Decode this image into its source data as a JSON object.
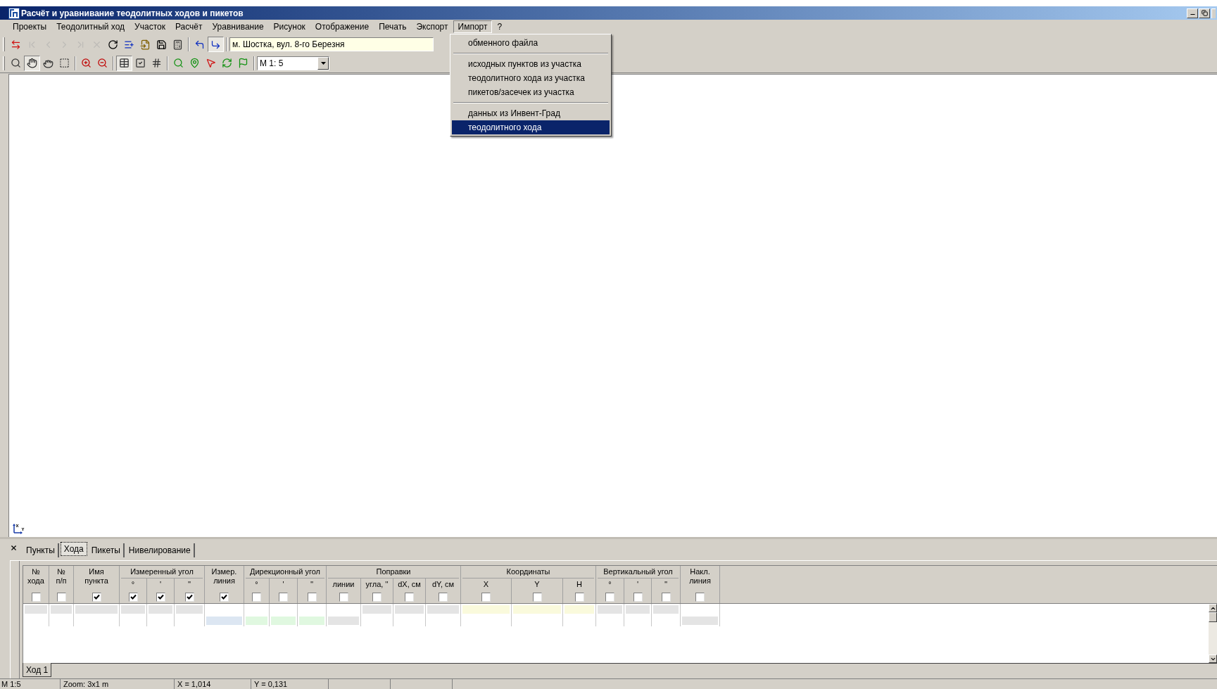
{
  "window": {
    "title": "Расчёт и уравнивание теодолитных ходов и пикетов"
  },
  "menu_bar": [
    {
      "label": "Проекты",
      "open": false
    },
    {
      "label": "Теодолитный ход",
      "open": false
    },
    {
      "label": "Участок",
      "open": false
    },
    {
      "label": "Расчёт",
      "open": false
    },
    {
      "label": "Уравнивание",
      "open": false
    },
    {
      "label": "Рисунок",
      "open": false
    },
    {
      "label": "Отображение",
      "open": false
    },
    {
      "label": "Печать",
      "open": false
    },
    {
      "label": "Экспорт",
      "open": false
    },
    {
      "label": "Импорт",
      "open": true
    },
    {
      "label": "?",
      "open": false
    }
  ],
  "import_menu": {
    "groups": [
      {
        "items": [
          {
            "label": "обменного файла",
            "selected": false
          }
        ]
      },
      {
        "items": [
          {
            "label": "исходных пунктов из участка",
            "selected": false
          },
          {
            "label": "теодолитного хода из участка",
            "selected": false
          },
          {
            "label": "пикетов/засечек из участка",
            "selected": false
          }
        ]
      },
      {
        "items": [
          {
            "label": "данных из Инвент-Град",
            "selected": false
          },
          {
            "label": "теодолитного хода",
            "selected": true
          }
        ]
      }
    ]
  },
  "toolbar_1": {
    "groups": [
      {
        "items": [
          {
            "kind": "swap",
            "disabled": false,
            "pressed": false
          },
          {
            "kind": "first",
            "disabled": true,
            "pressed": false
          },
          {
            "kind": "prev",
            "disabled": true,
            "pressed": false
          },
          {
            "kind": "next",
            "disabled": true,
            "pressed": false
          },
          {
            "kind": "last",
            "disabled": true,
            "pressed": false
          },
          {
            "kind": "delete",
            "disabled": true,
            "pressed": false
          },
          {
            "kind": "refresh",
            "disabled": false,
            "pressed": false
          },
          {
            "kind": "insert",
            "disabled": false,
            "pressed": false
          },
          {
            "kind": "import",
            "disabled": false,
            "pressed": false
          },
          {
            "kind": "save",
            "disabled": false,
            "pressed": false
          },
          {
            "kind": "calculator",
            "disabled": false,
            "pressed": false
          }
        ]
      },
      {
        "items": [
          {
            "kind": "back",
            "disabled": false,
            "pressed": false
          },
          {
            "kind": "forward",
            "disabled": false,
            "pressed": true
          }
        ]
      }
    ],
    "address": "м. Шостка, вул. 8-го Березня"
  },
  "toolbar_2": {
    "groups": [
      {
        "items": [
          {
            "kind": "zoom-window",
            "pressed": false
          },
          {
            "kind": "pan",
            "pressed": true
          },
          {
            "kind": "pan-alt",
            "pressed": false
          },
          {
            "kind": "select",
            "pressed": false
          }
        ]
      },
      {
        "items": [
          {
            "kind": "zoom-in",
            "pressed": false
          },
          {
            "kind": "zoom-out",
            "pressed": false
          }
        ]
      },
      {
        "items": [
          {
            "kind": "table",
            "pressed": true
          },
          {
            "kind": "table-check",
            "pressed": false
          },
          {
            "kind": "table-number",
            "pressed": false
          }
        ]
      },
      {
        "items": [
          {
            "kind": "green-search",
            "pressed": false
          },
          {
            "kind": "green-pin",
            "pressed": false
          },
          {
            "kind": "green-pointer",
            "pressed": false
          },
          {
            "kind": "green-rotate",
            "pressed": false
          },
          {
            "kind": "green-flag",
            "pressed": false
          }
        ]
      }
    ],
    "scale": "М 1: 5"
  },
  "panel_tabs": [
    {
      "label": "Пункты",
      "selected": false
    },
    {
      "label": "Хода",
      "selected": true
    },
    {
      "label": "Пикеты",
      "selected": false
    },
    {
      "label": "Нивелирование",
      "selected": false
    }
  ],
  "grid": {
    "columns": [
      {
        "kind": "single",
        "label": "№\nхода",
        "checked": false,
        "cells": [
          {
            "kind": "computed"
          },
          {
            "kind": "empty"
          }
        ]
      },
      {
        "kind": "single",
        "label": "№\nп/п",
        "checked": false,
        "cells": [
          {
            "kind": "computed"
          },
          {
            "kind": "empty"
          }
        ]
      },
      {
        "kind": "single",
        "label": "Имя\nпункта",
        "checked": true,
        "cells": [
          {
            "kind": "computed"
          },
          {
            "kind": "empty"
          }
        ]
      },
      {
        "kind": "group",
        "label": "Измеренный угол",
        "columns": [
          {
            "label": "°",
            "checked": true,
            "cells": [
              {
                "kind": "computed"
              },
              {
                "kind": "empty"
              }
            ]
          },
          {
            "label": "'",
            "checked": true,
            "cells": [
              {
                "kind": "computed"
              },
              {
                "kind": "empty"
              }
            ]
          },
          {
            "label": "''",
            "checked": true,
            "cells": [
              {
                "kind": "computed"
              },
              {
                "kind": "empty"
              }
            ]
          }
        ]
      },
      {
        "kind": "single",
        "label": "Измер.\nлиния",
        "checked": true,
        "cells": [
          {
            "kind": "empty"
          },
          {
            "kind": "measured"
          }
        ]
      },
      {
        "kind": "group",
        "label": "Дирекционный угол",
        "columns": [
          {
            "label": "°",
            "checked": false,
            "cells": [
              {
                "kind": "empty"
              },
              {
                "kind": "direction"
              }
            ]
          },
          {
            "label": "'",
            "checked": false,
            "cells": [
              {
                "kind": "empty"
              },
              {
                "kind": "direction"
              }
            ]
          },
          {
            "label": "''",
            "checked": false,
            "cells": [
              {
                "kind": "empty"
              },
              {
                "kind": "direction"
              }
            ]
          }
        ]
      },
      {
        "kind": "group",
        "label": "Поправки",
        "columns": [
          {
            "label": "линии",
            "checked": false,
            "cells": [
              {
                "kind": "empty"
              },
              {
                "kind": "computed"
              }
            ]
          },
          {
            "label": "угла, ''",
            "checked": false,
            "cells": [
              {
                "kind": "computed"
              },
              {
                "kind": "empty"
              }
            ]
          },
          {
            "label": "dX, см",
            "checked": false,
            "cells": [
              {
                "kind": "computed"
              },
              {
                "kind": "empty"
              }
            ]
          },
          {
            "label": "dY, см",
            "checked": false,
            "cells": [
              {
                "kind": "computed"
              },
              {
                "kind": "empty"
              }
            ]
          }
        ]
      },
      {
        "kind": "group",
        "label": "Координаты",
        "columns": [
          {
            "label": "X",
            "checked": false,
            "cells": [
              {
                "kind": "coordinate"
              },
              {
                "kind": "empty"
              }
            ]
          },
          {
            "label": "Y",
            "checked": false,
            "cells": [
              {
                "kind": "coordinate"
              },
              {
                "kind": "empty"
              }
            ]
          },
          {
            "label": "H",
            "checked": false,
            "cells": [
              {
                "kind": "coordinate"
              },
              {
                "kind": "empty"
              }
            ]
          }
        ]
      },
      {
        "kind": "group",
        "label": "Вертикальный угол",
        "columns": [
          {
            "label": "°",
            "checked": false,
            "cells": [
              {
                "kind": "computed"
              },
              {
                "kind": "empty"
              }
            ]
          },
          {
            "label": "'",
            "checked": false,
            "cells": [
              {
                "kind": "computed"
              },
              {
                "kind": "empty"
              }
            ]
          },
          {
            "label": "''",
            "checked": false,
            "cells": [
              {
                "kind": "computed"
              },
              {
                "kind": "empty"
              }
            ]
          }
        ]
      },
      {
        "kind": "single",
        "label": "Накл.\nлиния",
        "checked": false,
        "cells": [
          {
            "kind": "empty"
          },
          {
            "kind": "computed"
          }
        ]
      }
    ]
  },
  "sheet_tabs": [
    {
      "label": "Ход 1",
      "selected": true
    }
  ],
  "status_bar": [
    "М 1:5",
    "Zoom: 3x1 m",
    "X = 1,014",
    "Y = 0,131"
  ]
}
